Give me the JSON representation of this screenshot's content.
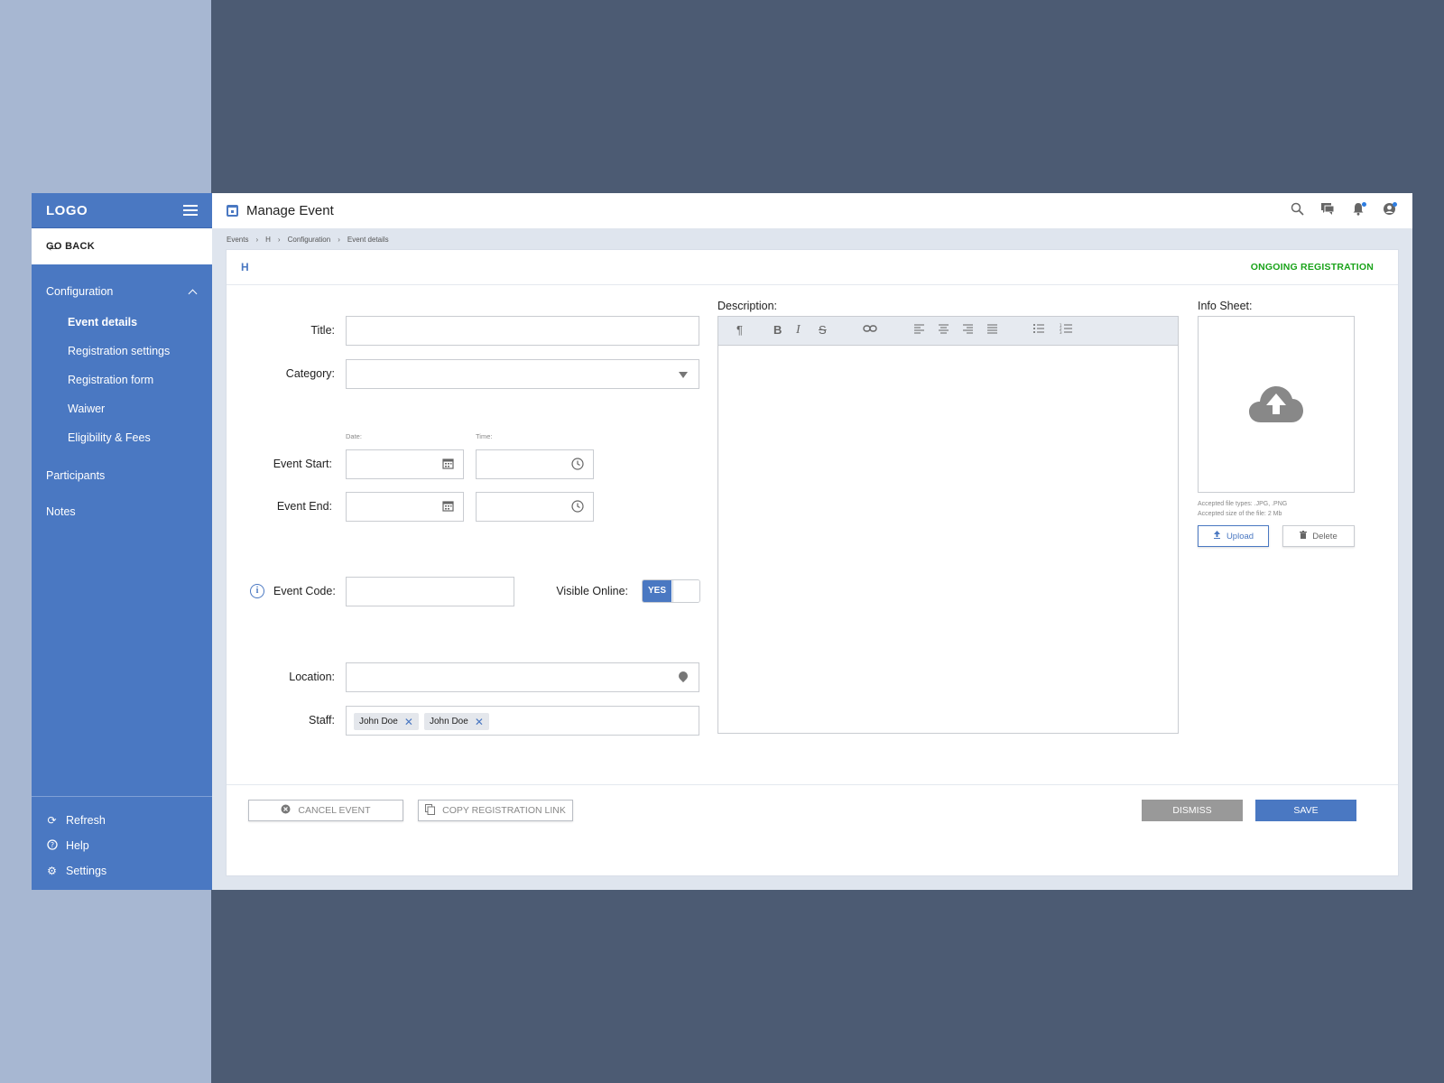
{
  "sidebar": {
    "logo": "LOGO",
    "back_label": "GO BACK",
    "section": "Configuration",
    "sub_items": [
      "Event details",
      "Registration settings",
      "Registration form",
      "Waiwer",
      "Eligibility & Fees"
    ],
    "items": [
      "Participants",
      "Notes"
    ],
    "bottom": [
      {
        "label": "Refresh",
        "icon": "refresh-icon"
      },
      {
        "label": "Help",
        "icon": "help-icon"
      },
      {
        "label": "Settings",
        "icon": "settings-icon"
      }
    ]
  },
  "header": {
    "title": "Manage Event",
    "icons": [
      "search-icon",
      "chat-icon",
      "bell-icon",
      "user-icon"
    ]
  },
  "breadcrumb": [
    "Events",
    "H",
    "Configuration",
    "Event details"
  ],
  "panel": {
    "heading": "H",
    "status": "ONGOING REGISTRATION",
    "status_color": "#1aa31a"
  },
  "form": {
    "title_label": "Title:",
    "category_label": "Category:",
    "date_label": "Date:",
    "time_label": "Time:",
    "event_start_label": "Event Start:",
    "event_end_label": "Event End:",
    "event_code_label": "Event Code:",
    "visible_online_label": "Visible Online:",
    "visible_online_value": "YES",
    "location_label": "Location:",
    "staff_label": "Staff:",
    "staff": [
      "John Doe",
      "John Doe"
    ]
  },
  "description": {
    "label": "Description:",
    "toolbar": [
      "paragraph-icon",
      "bold-icon",
      "italic-icon",
      "strikethrough-icon",
      "link-icon",
      "align-left-icon",
      "align-center-icon",
      "align-right-icon",
      "align-justify-icon",
      "bullet-list-icon",
      "numbered-list-icon"
    ]
  },
  "info_sheet": {
    "label": "Info Sheet:",
    "accepted_types": "Accepted file types: .JPG, .PNG",
    "accepted_size": "Accepted size of the file: 2 Mb",
    "upload_label": "Upload",
    "delete_label": "Delete"
  },
  "footer": {
    "cancel_label": "CANCEL EVENT",
    "copy_label": "COPY REGISTRATION LINK",
    "dismiss_label": "DISMISS",
    "save_label": "SAVE"
  },
  "colors": {
    "accent": "#4a78c2",
    "dismiss": "#999999",
    "save": "#4a78c2"
  }
}
